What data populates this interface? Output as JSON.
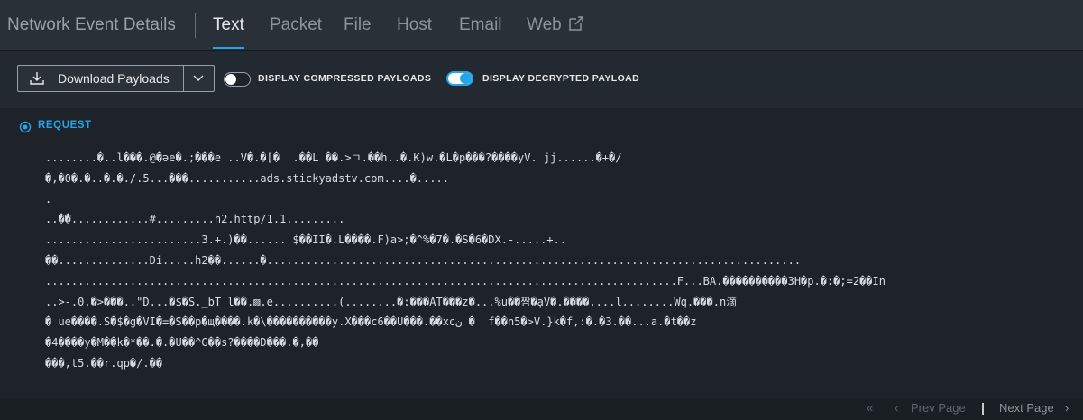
{
  "tabs": {
    "title": "Network Event Details",
    "text": "Text",
    "packet": "Packet",
    "file": "File",
    "host": "Host",
    "email": "Email",
    "web": "Web",
    "active": "Text",
    "external_icon": "external-link-icon"
  },
  "toolbar": {
    "download_label": "Download Payloads",
    "download_icon": "download-icon",
    "dropdown_icon": "chevron-down-icon",
    "compressed_label": "DISPLAY COMPRESSED PAYLOADS",
    "compressed_on": false,
    "decrypted_label": "DISPLAY DECRYPTED PAYLOAD",
    "decrypted_on": true
  },
  "section": {
    "label": "REQUEST",
    "icon": "collapse-circle-icon"
  },
  "payload_lines": [
    "........�..l���.@�ǝe�.;���e ..V�.�[�  .��L ��.>ㄱ.��h..�.K)w.�L�p���?����yV. jj......�+�/",
    "�,�0�.�..�.�./.5...���...........ads.stickyadstv.com....�.....",
    ".",
    "..��............#.........h2.http/1.1.........",
    "........................3.+.)��...... $��II�.L����.F)a>;�^%�7�.�S�6�DX.-.....+..",
    "��..............Di.....h2��......�..................................................................................",
    ".................................................................................................F...BA.����������3H�p.�:�;=2��In",
    "..>-.0.�>���..\"D...�$�S._bT l��.▨.e..........(........�:���AT���z�...%u��짬�ạV�.����....l........Wq.���.n滴",
    "� ue����.S�$�g�VI�=�S��p�щ����.k�\\����������y.X���c6��U���.��xcن �  f��n5�>V.}k�f,:�.�3.��...a.�t��z",
    "�4����y�M��k�*��.�.�U��^G��s?����D���.�,��",
    "���,t5.��r.qp�/.��"
  ],
  "pager": {
    "first_symbol": "«",
    "prev_symbol": "‹",
    "prev_label": "Prev Page",
    "separator": "|",
    "next_label": "Next Page",
    "next_symbol": "›"
  },
  "colors": {
    "accent": "#25a3e6",
    "background": "#1e2329",
    "tabbar": "#2a3038"
  }
}
